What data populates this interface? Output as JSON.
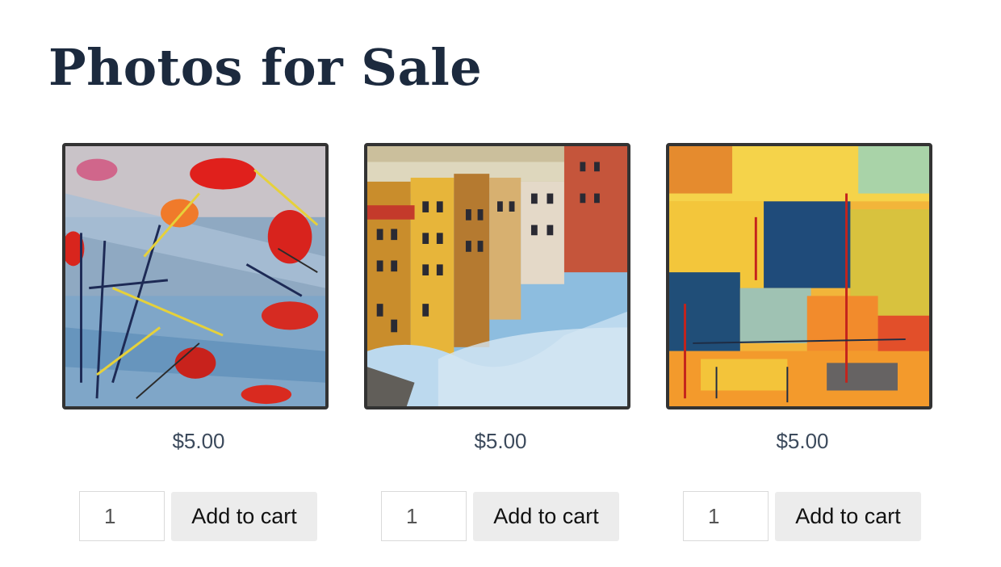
{
  "page": {
    "title": "Photos for Sale"
  },
  "products": [
    {
      "price": "$5.00",
      "quantity": "1",
      "button_label": "Add to cart",
      "image_subject": "abstract painting with red and blue strokes"
    },
    {
      "price": "$5.00",
      "quantity": "1",
      "button_label": "Add to cart",
      "image_subject": "painting of buildings reflected in water"
    },
    {
      "price": "$5.00",
      "quantity": "1",
      "button_label": "Add to cart",
      "image_subject": "abstract painting with yellow and blue blocks"
    }
  ],
  "colors": {
    "title": "#1c2a3e",
    "price": "#3c4a5c",
    "image_border": "#333333",
    "button_bg": "#ececec"
  }
}
